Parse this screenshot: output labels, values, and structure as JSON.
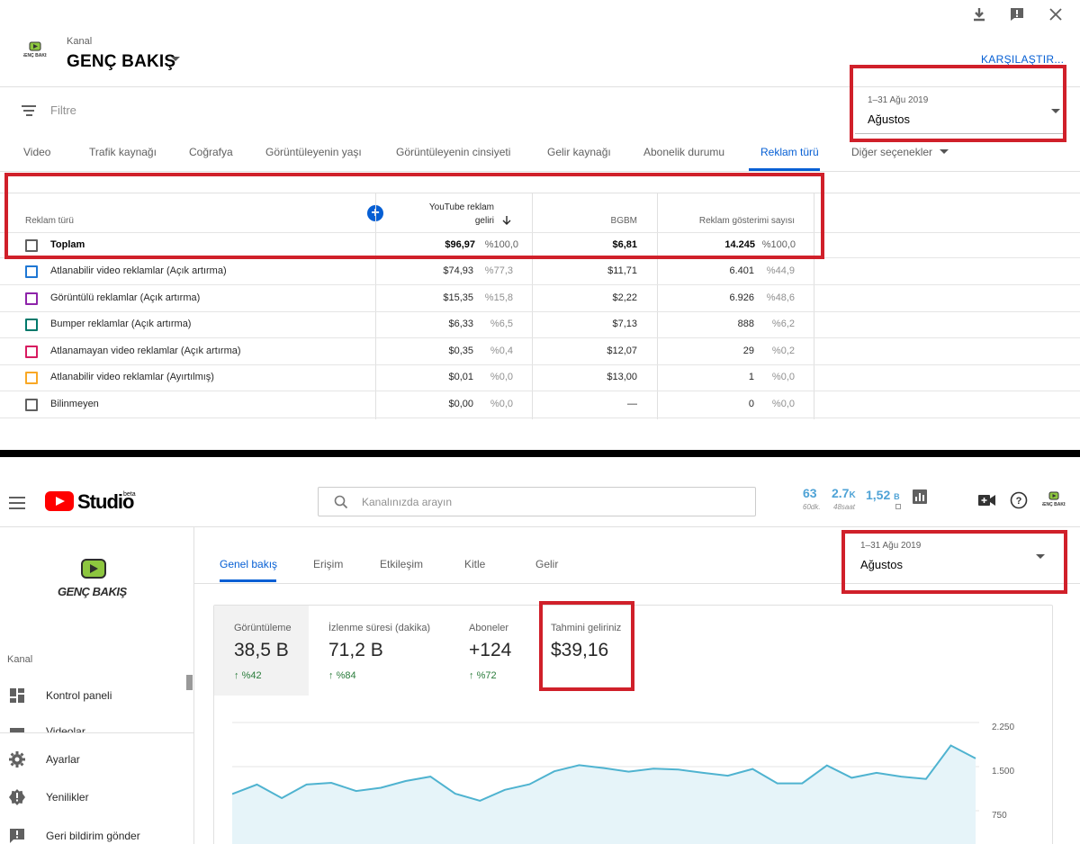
{
  "top": {
    "channel_label": "Kanal",
    "channel_name": "GENÇ BAKIŞ",
    "compare_label": "KARŞILAŞTIR...",
    "filter_placeholder": "Filtre",
    "date_range": "1–31 Ağu 2019",
    "date_name": "Ağustos",
    "tabs": [
      "Video",
      "Trafik kaynağı",
      "Coğrafya",
      "Görüntüleyenin yaşı",
      "Görüntüleyenin cinsiyeti",
      "Gelir kaynağı",
      "Abonelik durumu",
      "Reklam türü",
      "Diğer seçenekler"
    ],
    "active_tab": "Reklam türü",
    "table": {
      "headers": {
        "type": "Reklam türü",
        "revenue_line1": "YouTube reklam",
        "revenue_line2": "geliri",
        "cpm": "BGBM",
        "impressions": "Reklam gösterimi sayısı"
      },
      "total": {
        "name": "Toplam",
        "revenue": "$96,97",
        "revenue_pct": "%100,0",
        "cpm": "$6,81",
        "impressions": "14.245",
        "impressions_pct": "%100,0"
      },
      "rows": [
        {
          "name": "Atlanabilir video reklamlar (Açık artırma)",
          "color": "#1f77d4",
          "revenue": "$74,93",
          "revenue_pct": "%77,3",
          "cpm": "$11,71",
          "impressions": "6.401",
          "impressions_pct": "%44,9"
        },
        {
          "name": "Görüntülü reklamlar (Açık artırma)",
          "color": "#8e24aa",
          "revenue": "$15,35",
          "revenue_pct": "%15,8",
          "cpm": "$2,22",
          "impressions": "6.926",
          "impressions_pct": "%48,6"
        },
        {
          "name": "Bumper reklamlar (Açık artırma)",
          "color": "#00796b",
          "revenue": "$6,33",
          "revenue_pct": "%6,5",
          "cpm": "$7,13",
          "impressions": "888",
          "impressions_pct": "%6,2"
        },
        {
          "name": "Atlanamayan video reklamlar (Açık artırma)",
          "color": "#d81b60",
          "revenue": "$0,35",
          "revenue_pct": "%0,4",
          "cpm": "$12,07",
          "impressions": "29",
          "impressions_pct": "%0,2"
        },
        {
          "name": "Atlanabilir video reklamlar (Ayırtılmış)",
          "color": "#f9a825",
          "revenue": "$0,01",
          "revenue_pct": "%0,0",
          "cpm": "$13,00",
          "impressions": "1",
          "impressions_pct": "%0,0"
        },
        {
          "name": "Bilinmeyen",
          "color": "#606060",
          "revenue": "$0,00",
          "revenue_pct": "%0,0",
          "cpm": "—",
          "impressions": "0",
          "impressions_pct": "%0,0"
        }
      ]
    }
  },
  "bottom": {
    "app_name": "Studio",
    "beta_label": "beta",
    "search_placeholder": "Kanalınızda arayın",
    "stats": [
      {
        "value": "63",
        "sub": "60dk."
      },
      {
        "value": "2.7",
        "unit": "K",
        "sub": "48saat"
      },
      {
        "value": "1,52",
        "unit": "B",
        "sub": ""
      }
    ],
    "channel_logo_text": "GENÇ BAKIŞ",
    "sidebar_section": "Kanal",
    "sidebar_items": [
      "Kontrol paneli",
      "Videolar",
      "Ayarlar",
      "Yenilikler",
      "Geri bildirim gönder"
    ],
    "tabs": [
      "Genel bakış",
      "Erişim",
      "Etkileşim",
      "Kitle",
      "Gelir"
    ],
    "date_range": "1–31 Ağu 2019",
    "date_name": "Ağustos",
    "metrics": [
      {
        "label": "Görüntüleme",
        "value": "38,5 B",
        "delta": "%42"
      },
      {
        "label": "İzlenme süresi (dakika)",
        "value": "71,2 B",
        "delta": "%84"
      },
      {
        "label": "Aboneler",
        "value": "+124",
        "delta": "%72"
      },
      {
        "label": "Tahmini geliriniz",
        "value": "$39,16",
        "delta": ""
      }
    ]
  },
  "chart_data": {
    "type": "area",
    "y_ticks": [
      "2.250",
      "1.500",
      "750"
    ],
    "ylim": [
      0,
      2250
    ],
    "color": "#4fb3d0",
    "values": [
      1035,
      1195,
      965,
      1195,
      1225,
      1085,
      1140,
      1255,
      1330,
      1040,
      920,
      1105,
      1200,
      1420,
      1525,
      1475,
      1415,
      1465,
      1450,
      1395,
      1345,
      1460,
      1215,
      1215,
      1520,
      1310,
      1395,
      1330,
      1290,
      1860,
      1640
    ]
  }
}
